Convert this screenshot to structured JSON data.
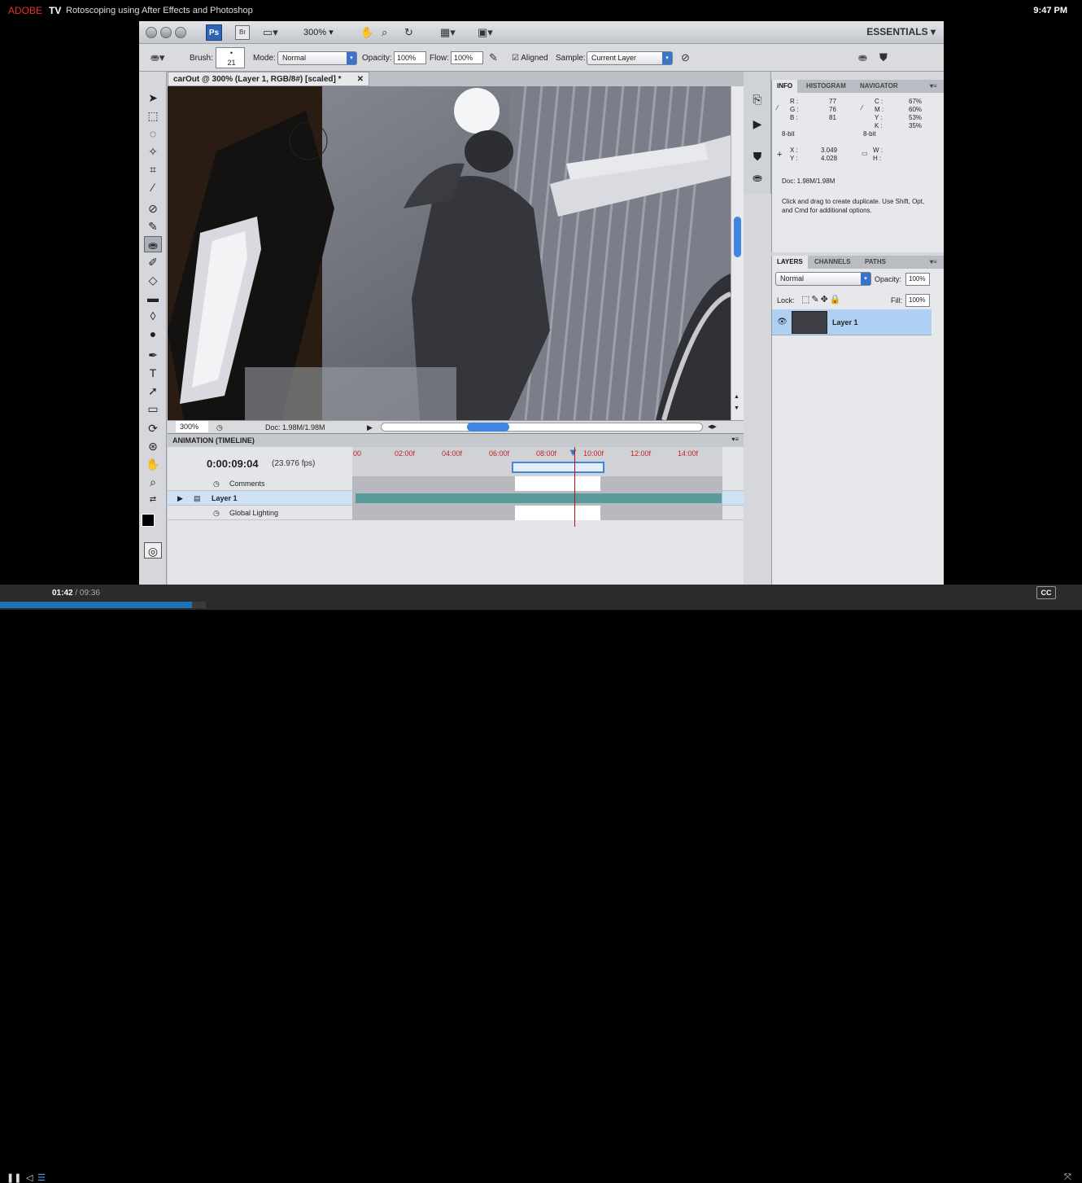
{
  "player": {
    "brand": "ADOBE",
    "brand_suffix": "TV",
    "video_title": "Rotoscoping using After Effects and Photoshop",
    "clock": "9:47 PM",
    "elapsed": "01:42",
    "duration": "/ 09:36",
    "cc_label": "CC",
    "progress_fraction": 0.177,
    "accent_color": "#e8312a",
    "progress_color": "#1e73b8"
  },
  "app": {
    "ps_label": "Ps",
    "br_label": "Br",
    "zoom": "300% ▾",
    "workspace": "ESSENTIALS ▾"
  },
  "options": {
    "brush_label": "Brush:",
    "brush_size": "21",
    "mode_label": "Mode:",
    "mode_value": "Normal",
    "opacity_label": "Opacity:",
    "opacity_value": "100%",
    "flow_label": "Flow:",
    "flow_value": "100%",
    "aligned_label": "Aligned",
    "sample_label": "Sample:",
    "sample_value": "Current Layer"
  },
  "document": {
    "tab_title": "carOut @ 300% (Layer 1, RGB/8#) [scaled] *",
    "zoom_status": "300%",
    "doc_size": "Doc: 1.98M/1.98M"
  },
  "timeline": {
    "header": "ANIMATION (TIMELINE)",
    "current_time": "0:00:09:04",
    "fps": "(23.976 fps)",
    "ruler": [
      "00",
      "02:00f",
      "04:00f",
      "06:00f",
      "08:00f",
      "10:00f",
      "12:00f",
      "14:00f"
    ],
    "rows": [
      "Comments",
      "Layer 1",
      "Global Lighting"
    ]
  },
  "info_panel": {
    "tabs": [
      "INFO",
      "HISTOGRAM",
      "NAVIGATOR"
    ],
    "r_label": "R :",
    "r": "77",
    "g_label": "G :",
    "g": "76",
    "b_label": "B :",
    "b": "81",
    "c_label": "C :",
    "c": "67%",
    "m_label": "M :",
    "m": "60%",
    "y_label": "Y :",
    "y": "53%",
    "k_label": "K :",
    "k": "35%",
    "bit_left": "8-bit",
    "bit_right": "8-bit",
    "x_label": "X :",
    "x": "3.049",
    "yy_label": "Y :",
    "yy": "4.028",
    "w_label": "W :",
    "h_label": "H :",
    "doc": "Doc: 1.98M/1.98M",
    "hint": "Click and drag to create duplicate.  Use Shift, Opt, and Cmd for additional options."
  },
  "layers_panel": {
    "tabs": [
      "LAYERS",
      "CHANNELS",
      "PATHS"
    ],
    "blend": "Normal",
    "opacity_label": "Opacity:",
    "opacity": "100%",
    "lock_label": "Lock:",
    "fill_label": "Fill:",
    "fill": "100%",
    "layer_name": "Layer 1"
  }
}
